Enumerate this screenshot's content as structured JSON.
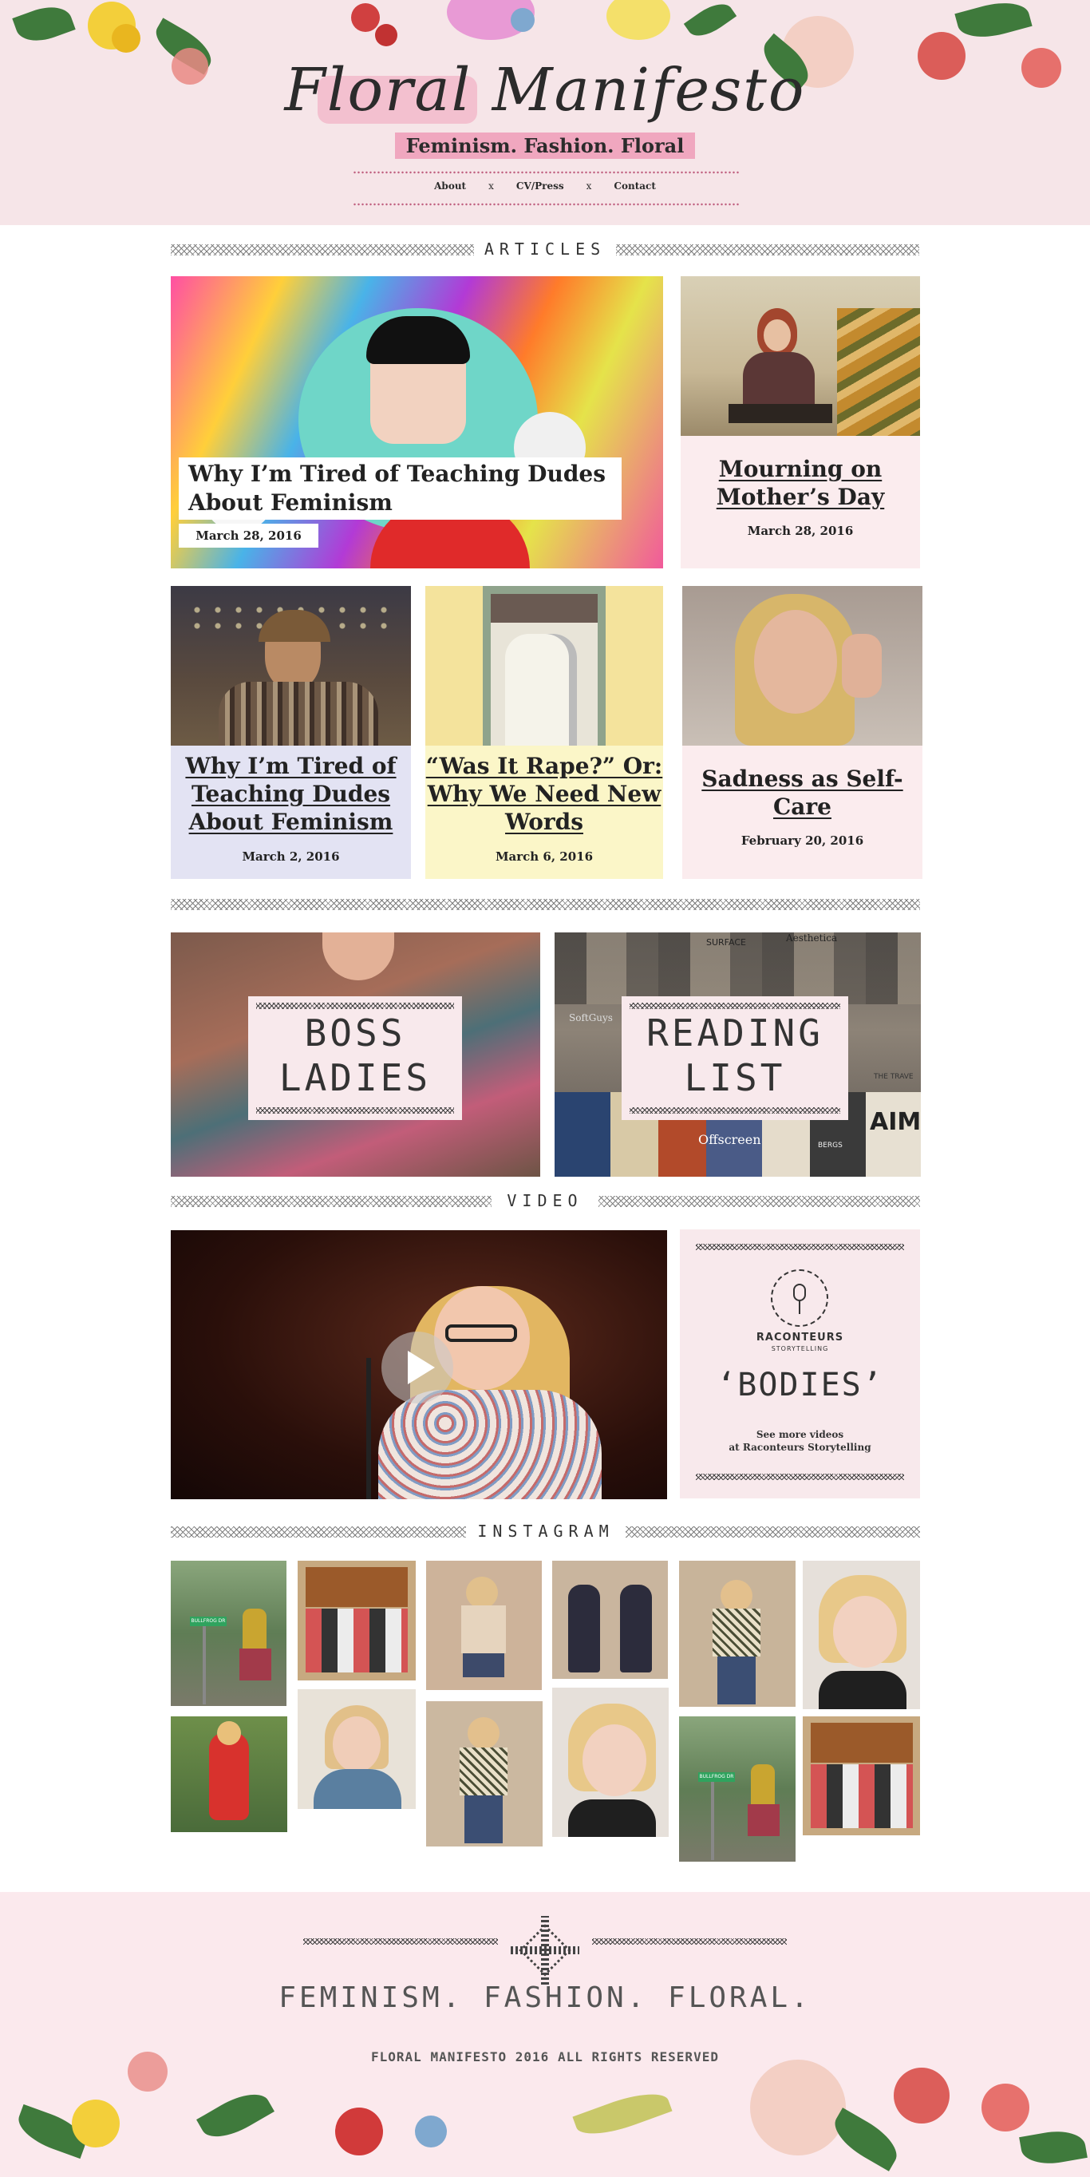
{
  "site": {
    "title": "Floral Manifesto",
    "tagline": "Feminism. Fashion. Floral"
  },
  "nav": {
    "items": [
      "About",
      "CV/Press",
      "Contact"
    ],
    "separator": "x"
  },
  "sections": {
    "articles": "ARTICLES",
    "video": "VIDEO",
    "instagram": "INSTAGRAM"
  },
  "articles": [
    {
      "title": "Why I’m Tired of Teaching Dudes About Feminism",
      "date": "March 28, 2016"
    },
    {
      "title": "Mourning on Mother’s Day",
      "date": "March 28, 2016"
    },
    {
      "title": "Why I’m Tired of Teaching Dudes About Feminism",
      "date": "March 2, 2016"
    },
    {
      "title": "“Was It Rape?” Or: Why We Need New Words",
      "date": "March 6, 2016"
    },
    {
      "title": "Sadness as Self-Care",
      "date": "February 20, 2016"
    }
  ],
  "promos": {
    "boss_ladies_line1": "BOSS",
    "boss_ladies_line2": "LADIES",
    "reading_list_line1": "READING",
    "reading_list_line2": "LIST"
  },
  "video": {
    "brand": "RACONTEURS",
    "brand_sub": "STORYTELLING",
    "title": "‘BODIES’",
    "more_line1": "See more videos",
    "more_line2": "at Raconteurs Storytelling",
    "image_text": {
      "record_sign1": "SURFACE",
      "record_sign2": "Aesthetica",
      "record_sign3": "Offscreen",
      "record_sign4": "AIM",
      "record_sign5": "SoftGuys",
      "record_sign6": "THE TRAVE",
      "record_sign7": "BERGS",
      "street_sign": "BULLFROG DR"
    }
  },
  "footer": {
    "tagline": "FEMINISM. FASHION. FLORAL.",
    "copyright": "FLORAL MANIFESTO 2016 ALL RIGHTS RESERVED"
  },
  "colors": {
    "header_bg": "#f6e5e8",
    "highlight_pink": "#f0a7bf",
    "card_pink": "#fbecee",
    "card_lavender": "#e3e3f3",
    "card_yellow": "#fbf6c8",
    "footer_bg": "#fbe9ed"
  }
}
